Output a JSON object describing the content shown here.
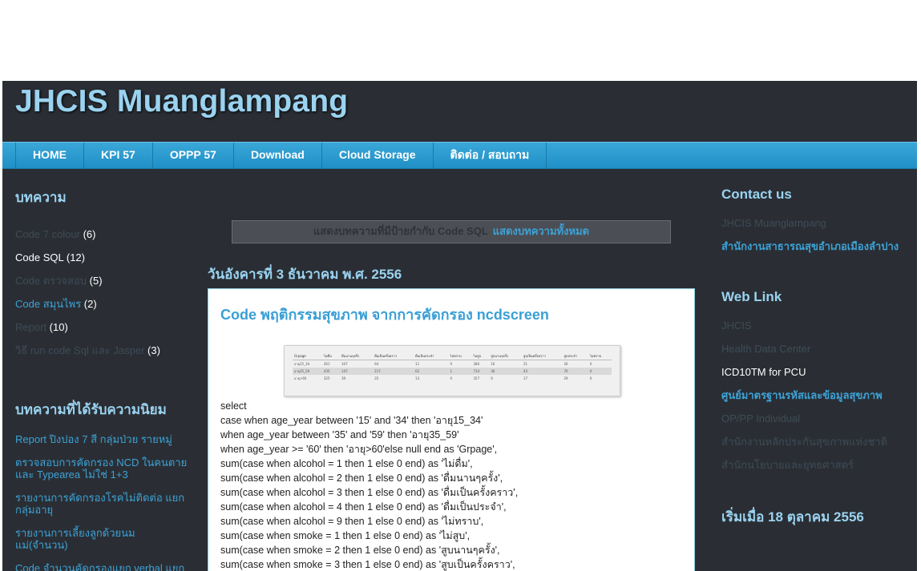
{
  "blog": {
    "title": "JHCIS Muanglampang"
  },
  "nav": {
    "items": [
      "HOME",
      "KPI 57",
      "OPPP 57",
      "Download",
      "Cloud Storage",
      "ติดต่อ / สอบถาม"
    ]
  },
  "left_sidebar": {
    "labels_heading": "บทความ",
    "labels": [
      {
        "name": "Code 7 colour",
        "count": "(6)",
        "style": "dim"
      },
      {
        "name": "Code SQL",
        "count": "(12)",
        "style": "current"
      },
      {
        "name": "Code ตรวจสอบ",
        "count": "(5)",
        "style": "dim"
      },
      {
        "name": "Code สมุนไพร",
        "count": "(2)",
        "style": "link"
      },
      {
        "name": "Report",
        "count": "(10)",
        "style": "dim"
      },
      {
        "name": "วิธี run code Sql และ Jasper",
        "count": "(3)",
        "style": "dim"
      }
    ],
    "popular_heading": "บทความที่ได้รับความนิยม",
    "popular": [
      "Report ปิงปอง 7 สี กลุ่มป่วย รายหมู่",
      "ตรวจสอบการคัดกรอง NCD ในคนตาย และ Typearea ไม่ใช่ 1+3",
      "รายงานการคัดกรองโรคไม่ติดต่อ แยกกลุ่มอายุ",
      "รายงานการเลี้ยงลูกด้วยนมแม่(จำนวน)",
      "Code จำนวนคัดกรองแยก verbal แยกกลุ่มสี แยกเพศ แยกอายุ"
    ]
  },
  "main": {
    "status_text": "แสดงบทความที่มีป้ายกำกับ Code SQL",
    "show_all_link": "แสดงบทความทั้งหมด",
    "date_header": "วันอังคารที่ 3 ธันวาคม พ.ศ. 2556",
    "post": {
      "title": "Code พฤติกรรมสุขภาพ จากการคัดกรอง ncdscreen",
      "image_table": {
        "headers": [
          "Grpage",
          "ไม่ดื่ม",
          "ดื่มนานๆครั้ง",
          "ดื่มเป็นครั้งคราว",
          "ดื่มเป็นประจำ",
          "ไม่ทราบ",
          "ไม่สูบ",
          "สูบนานๆครั้ง",
          "สูบเป็นครั้งคราว",
          "สูบประจำ",
          "ไม่ทราบ"
        ],
        "rows": [
          [
            "อายุ15_34",
            "261",
            "107",
            "64",
            "11",
            "0",
            "380",
            "16",
            "21",
            "26",
            "0"
          ],
          [
            "อายุ35_59",
            "435",
            "147",
            "217",
            "62",
            "1",
            "714",
            "36",
            "43",
            "70",
            "0"
          ],
          [
            "อายุ>60",
            "325",
            "39",
            "35",
            "13",
            "0",
            "357",
            "9",
            "17",
            "29",
            "0"
          ]
        ]
      },
      "code_lines": [
        "select",
        "case when age_year between '15' and '34' then 'อายุ15_34'",
        "when age_year between '35' and '59' then 'อายุ35_59'",
        "when age_year >= '60' then 'อายุ>60'else null end as 'Grpage',",
        "sum(case when alcohol = 1 then 1 else 0 end) as 'ไม่ดื่ม',",
        "sum(case when alcohol = 2 then 1 else 0 end) as 'ดื่มนานๆครั้ง',",
        "sum(case when alcohol = 3 then 1 else 0 end) as 'ดื่มเป็นครั้งคราว',",
        "sum(case when alcohol = 4 then 1 else 0 end) as 'ดื่มเป็นประจำ',",
        "sum(case when alcohol = 9 then 1 else 0 end) as 'ไม่ทราบ',",
        "sum(case when smoke = 1 then 1 else 0 end) as 'ไม่สูบ',",
        "sum(case when smoke = 2 then 1 else 0 end) as 'สูบนานๆครั้ง',",
        "sum(case when smoke = 3 then 1 else 0 end) as 'สูบเป็นครั้งคราว',"
      ]
    }
  },
  "right_sidebar": {
    "contact_heading": "Contact us",
    "contact_items": [
      {
        "text": "JHCIS Muanglampang",
        "style": "dim"
      },
      {
        "text": "สำนักงานสาธารณสุขอำเภอเมืองลำปาง",
        "style": "bold"
      }
    ],
    "links_heading": "Web Link",
    "links": [
      {
        "text": "JHCIS",
        "style": "dim"
      },
      {
        "text": "Health Data Center",
        "style": "dim"
      },
      {
        "text": "ICD10TM for PCU",
        "style": "white"
      },
      {
        "text": "ศูนย์มาตรฐานรหัสและข้อมูลสุขภาพ",
        "style": "bold"
      },
      {
        "text": "OP/PP Individual",
        "style": "dim"
      },
      {
        "text": "สำนักงานหลักประกันสุขภาพแห่งชาติ",
        "style": "dim"
      },
      {
        "text": "สำนักนโยบายและยุทธศาสตร์",
        "style": "dim"
      }
    ],
    "started_heading": "เริ่มเมื่อ 18 ตุลาคม 2556"
  }
}
